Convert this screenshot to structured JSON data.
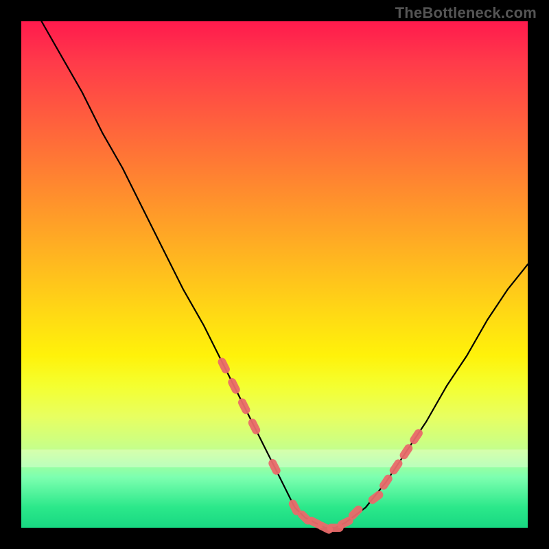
{
  "watermark": "TheBottleneck.com",
  "chart_data": {
    "type": "line",
    "title": "",
    "xlabel": "",
    "ylabel": "",
    "xlim": [
      0,
      100
    ],
    "ylim": [
      0,
      100
    ],
    "colors": {
      "gradient_top": "#ff1a4d",
      "gradient_mid": "#ffd800",
      "gradient_bottom": "#18d882",
      "curve": "#000000",
      "marker": "#e96a6a"
    },
    "series": [
      {
        "name": "bottleneck-curve",
        "x": [
          4,
          8,
          12,
          16,
          20,
          24,
          28,
          32,
          36,
          40,
          44,
          48,
          50,
          52,
          54,
          56,
          58,
          60,
          62,
          64,
          68,
          72,
          76,
          80,
          84,
          88,
          92,
          96,
          100
        ],
        "y": [
          100,
          93,
          86,
          78,
          71,
          63,
          55,
          47,
          40,
          32,
          24,
          16,
          12,
          8,
          4,
          2,
          1,
          0,
          0,
          1,
          4,
          9,
          15,
          21,
          28,
          34,
          41,
          47,
          52
        ]
      }
    ],
    "markers": {
      "name": "highlight-points",
      "x": [
        40,
        42,
        44,
        46,
        50,
        54,
        56,
        58,
        60,
        62,
        64,
        66,
        70,
        72,
        74,
        76,
        78
      ],
      "y": [
        32,
        28,
        24,
        20,
        12,
        4,
        2,
        1,
        0,
        0,
        1,
        3,
        6,
        9,
        12,
        15,
        18
      ]
    }
  }
}
